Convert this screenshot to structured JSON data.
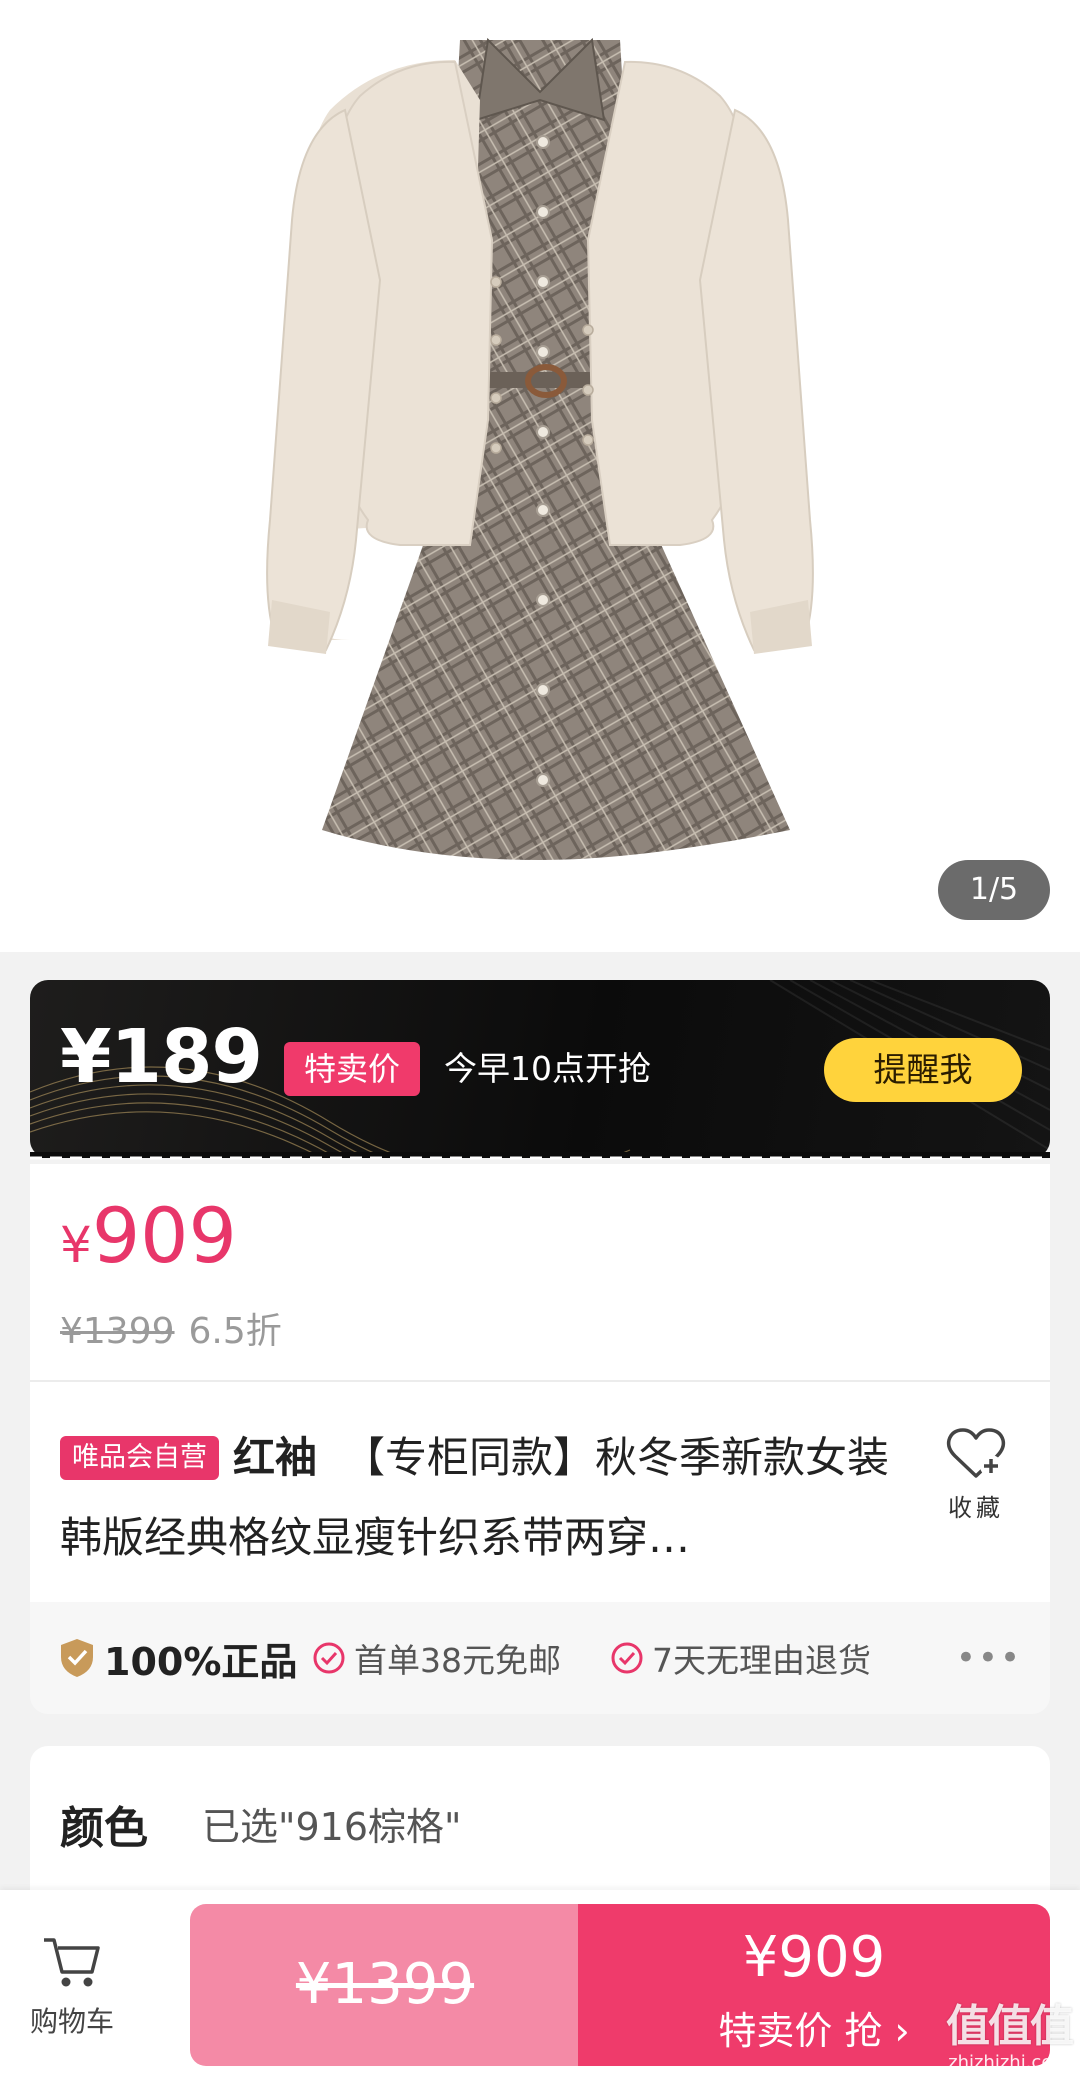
{
  "gallery": {
    "counter": "1/5"
  },
  "flash_sale": {
    "price": "¥189",
    "tag": "特卖价",
    "time_text": "今早10点开抢",
    "remind_button": "提醒我"
  },
  "price": {
    "currency": "¥",
    "current": "909",
    "original": "¥1399",
    "discount": "6.5折"
  },
  "title": {
    "self_operated_tag": "唯品会自营",
    "brand": "红袖",
    "text": "【专柜同款】秋冬季新款女装韩版经典格纹显瘦针织系带两穿…",
    "favorite_label": "收藏"
  },
  "guarantees": {
    "main": "100%正品",
    "items": [
      "首单38元免邮",
      "7天无理由退货"
    ],
    "more": "•••"
  },
  "spec": {
    "label": "颜色",
    "value": "已选\"916棕格\""
  },
  "bottom_bar": {
    "cart_label": "购物车",
    "original_price": "¥1399",
    "buy_price": "¥909",
    "buy_label": "特卖价 抢 ›"
  },
  "watermark": {
    "big": "值值值",
    "small": "zhizhizhi.com"
  },
  "colors": {
    "accent": "#ef3b6b",
    "price_pink": "#e8366a",
    "remind_yellow": "#ffd33c",
    "shield_gold": "#c89a5a"
  }
}
